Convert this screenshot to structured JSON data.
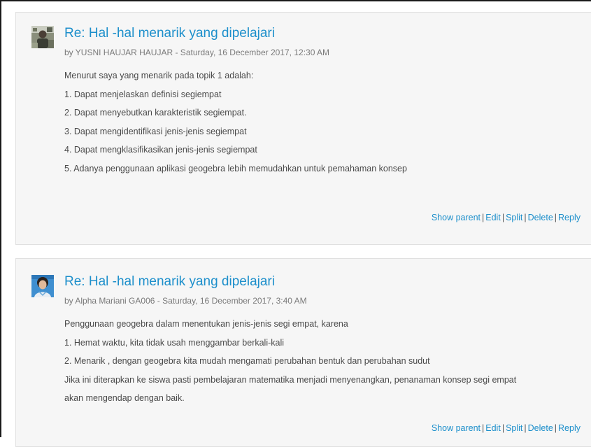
{
  "posts": [
    {
      "subject": "Re: Hal -hal menarik yang dipelajari",
      "byline": "by YUSNI HAUJAR HAUJAR - Saturday, 16 December 2017, 12:30 AM",
      "paragraphs": [
        "Menurut saya yang menarik pada topik 1 adalah:",
        "1. Dapat menjelaskan definisi segiempat",
        "2. Dapat menyebutkan karakteristik segiempat.",
        "3. Dapat mengidentifikasi jenis-jenis segiempat",
        "4. Dapat mengklasifikasikan jenis-jenis segiempat",
        "5. Adanya penggunaan aplikasi geogebra lebih memudahkan untuk pemahaman konsep"
      ],
      "commands": {
        "show_parent": "Show parent",
        "edit": "Edit",
        "split": "Split",
        "delete": "Delete",
        "reply": "Reply"
      }
    },
    {
      "subject": "Re: Hal -hal menarik yang dipelajari",
      "byline": "by Alpha Mariani GA006 - Saturday, 16 December 2017, 3:40 AM",
      "paragraphs": [
        "Penggunaan geogebra dalam menentukan jenis-jenis segi empat, karena",
        "1. Hemat waktu, kita tidak usah menggambar berkali-kali",
        "2. Menarik , dengan geogebra kita mudah mengamati perubahan bentuk dan perubahan sudut",
        "Jika ini diterapkan ke siswa pasti pembelajaran matematika menjadi menyenangkan, penanaman konsep segi empat",
        "akan mengendap dengan baik."
      ],
      "commands": {
        "show_parent": "Show parent",
        "edit": "Edit",
        "split": "Split",
        "delete": "Delete",
        "reply": "Reply"
      }
    }
  ],
  "separator": "|",
  "colors": {
    "link": "#1d8fcb",
    "body_text": "#4a4a4a",
    "meta_text": "#7a7a7a",
    "post_background": "#f6f6f6"
  }
}
